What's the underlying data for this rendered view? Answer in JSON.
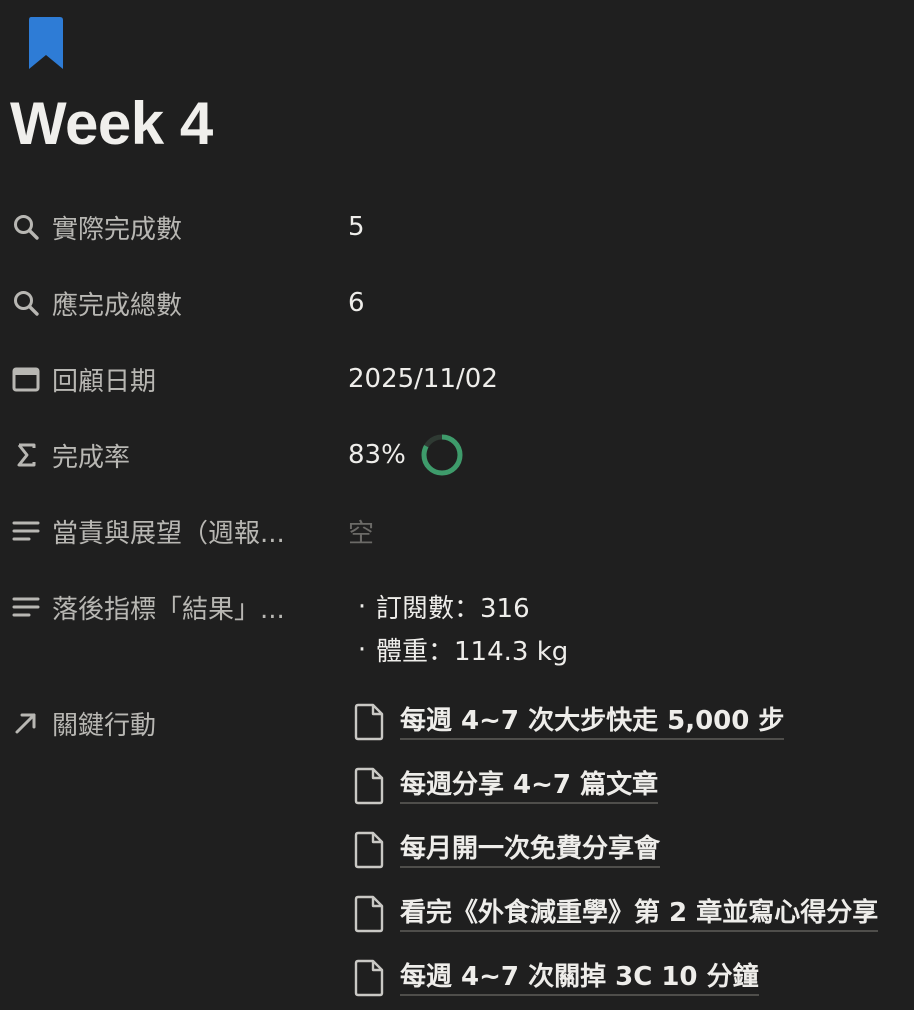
{
  "page": {
    "title": "Week 4",
    "icon": "bookmark-icon",
    "icon_color": "#2e7cd6"
  },
  "properties": [
    {
      "name": "實際完成數",
      "icon": "search-icon",
      "value": "5"
    },
    {
      "name": "應完成總數",
      "icon": "search-icon",
      "value": "6"
    },
    {
      "name": "回顧日期",
      "icon": "calendar-icon",
      "value": "2025/11/02"
    },
    {
      "name": "完成率",
      "icon": "sigma-icon",
      "value": "83%",
      "progress": 0.83,
      "progress_color": "#3e9b6b"
    },
    {
      "name": "當責與展望（週報...",
      "icon": "text-lines-icon",
      "value": "空"
    },
    {
      "name": "落後指標「結果」...",
      "icon": "text-lines-icon",
      "bullets": [
        "訂閱數：316",
        "體重：114.3 kg"
      ]
    },
    {
      "name": "關鍵行動",
      "icon": "relation-arrow-icon",
      "relations": [
        "每週 4~7 次大步快走 5,000 步",
        "每週分享 4~7 篇文章",
        "每月開一次免費分享會",
        "看完《外食減重學》第 2 章並寫心得分享",
        "每週 4~7 次關掉 3C 10 分鐘"
      ]
    }
  ]
}
